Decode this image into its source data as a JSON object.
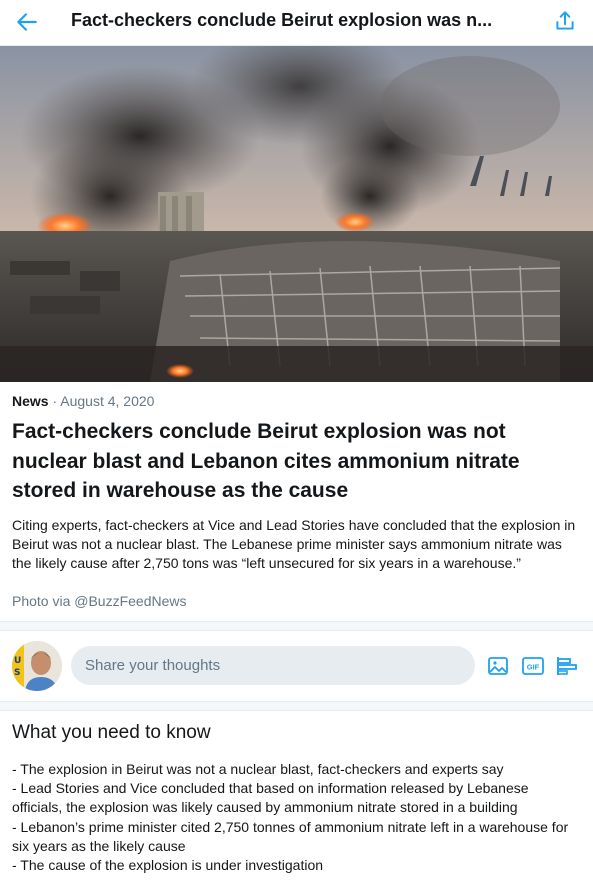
{
  "header": {
    "title": "Fact-checkers conclude Beirut explosion was n...",
    "back_icon": "arrow-left-icon",
    "share_icon": "share-upload-icon",
    "accent": "#1da1f2"
  },
  "article": {
    "category": "News",
    "separator": " · ",
    "date": "August 4, 2020",
    "headline": "Fact-checkers conclude Beirut explosion was not nuclear blast and Lebanon cites ammonium nitrate stored in warehouse as the cause",
    "summary": "Citing experts, fact-checkers at Vice and Lead Stories have concluded that the explosion in Beirut was not a nuclear blast. The Lebanese prime minister says ammonium nitrate was the likely cause after 2,750 tons was “left unsecured for six years in a warehouse.”",
    "credit": "Photo via @BuzzFeedNews"
  },
  "composer": {
    "placeholder": "Share your thoughts",
    "tools": [
      "image-icon",
      "gif-icon",
      "poll-icon"
    ],
    "gif_label": "GIF"
  },
  "need_to_know": {
    "title": "What you need to know",
    "bullets": [
      "- The explosion in Beirut was not a nuclear blast, fact-checkers and experts say",
      "- Lead Stories and Vice concluded that based on information released by Lebanese officials, the explosion was likely caused by ammonium nitrate stored in a building",
      "- Lebanon’s prime minister cited 2,750 tonnes of ammonium nitrate left in a warehouse for six years as the likely cause",
      "- The cause of the explosion is under investigation"
    ]
  }
}
